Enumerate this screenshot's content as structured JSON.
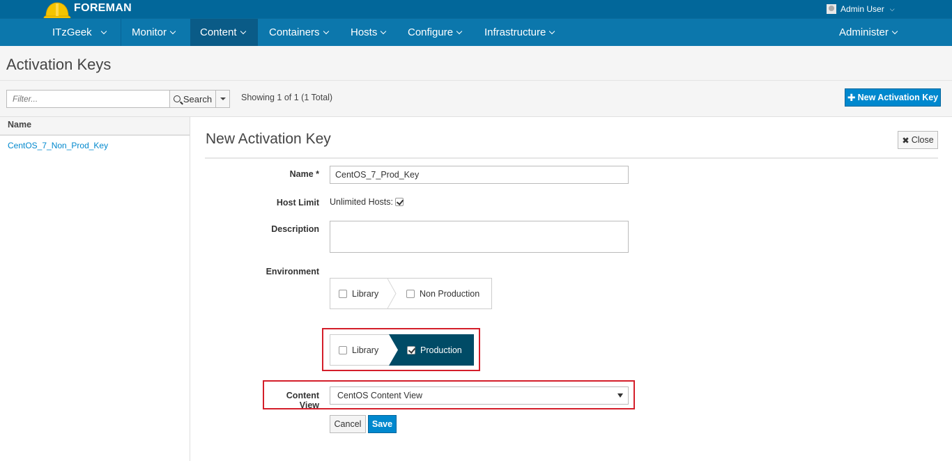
{
  "topbar": {
    "brand": "FOREMAN",
    "user": "Admin User"
  },
  "nav": {
    "org": "ITzGeek",
    "items": [
      "Monitor",
      "Content",
      "Containers",
      "Hosts",
      "Configure",
      "Infrastructure"
    ],
    "right": "Administer",
    "active": "Content"
  },
  "page": {
    "title": "Activation Keys"
  },
  "toolbar": {
    "filter_placeholder": "Filter...",
    "search_label": "Search",
    "showing": "Showing 1 of 1 (1 Total)",
    "new_key_label": "New Activation Key"
  },
  "list": {
    "header": "Name",
    "rows": [
      "CentOS_7_Non_Prod_Key"
    ]
  },
  "form": {
    "title": "New Activation Key",
    "close_label": "Close",
    "name_label": "Name *",
    "name_value": "CentOS_7_Prod_Key",
    "host_limit_label": "Host Limit",
    "unlimited_hosts_label": "Unlimited Hosts:",
    "unlimited_hosts_checked": true,
    "description_label": "Description",
    "environment_label": "Environment",
    "env_paths": [
      {
        "nodes": [
          {
            "label": "Library",
            "checked": false
          },
          {
            "label": "Non Production",
            "checked": false
          }
        ]
      },
      {
        "nodes": [
          {
            "label": "Library",
            "checked": false
          },
          {
            "label": "Production",
            "checked": true
          }
        ]
      }
    ],
    "content_view_label": "Content View",
    "content_view_value": "CentOS Content View",
    "cancel_label": "Cancel",
    "save_label": "Save"
  },
  "colors": {
    "topbar": "#02679a",
    "navbar": "#0c77ac",
    "primary": "#0088ce",
    "selected_env": "#004b66",
    "highlight": "#d41e2a"
  }
}
